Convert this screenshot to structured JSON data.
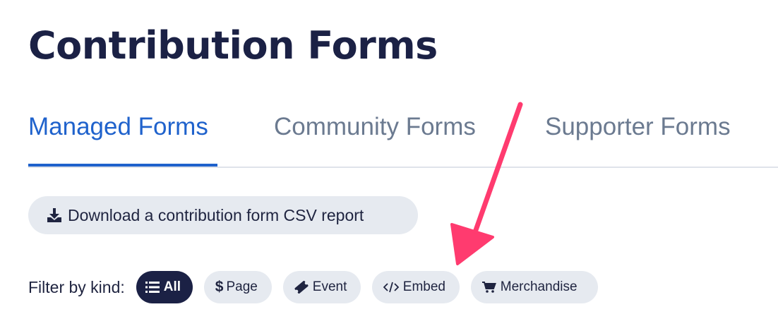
{
  "page": {
    "title": "Contribution Forms"
  },
  "tabs": [
    {
      "label": "Managed Forms",
      "active": true
    },
    {
      "label": "Community Forms",
      "active": false
    },
    {
      "label": "Supporter Forms",
      "active": false
    }
  ],
  "csv_button": {
    "label": "Download a contribution form CSV report",
    "icon": "download-icon"
  },
  "filter": {
    "label": "Filter by kind:",
    "chips": [
      {
        "label": "All",
        "icon": "list-icon",
        "active": true
      },
      {
        "label": "Page",
        "icon": "dollar-icon",
        "active": false
      },
      {
        "label": "Event",
        "icon": "ticket-icon",
        "active": false
      },
      {
        "label": "Embed",
        "icon": "code-icon",
        "active": false
      },
      {
        "label": "Merchandise",
        "icon": "cart-icon",
        "active": false
      }
    ]
  },
  "colors": {
    "title": "#1b2145",
    "tab_active": "#1f62cc",
    "tab_inactive": "#6b7a90",
    "chip_bg": "#e6eaf0",
    "chip_active_bg": "#1b2145",
    "arrow": "#ff3b6f"
  }
}
